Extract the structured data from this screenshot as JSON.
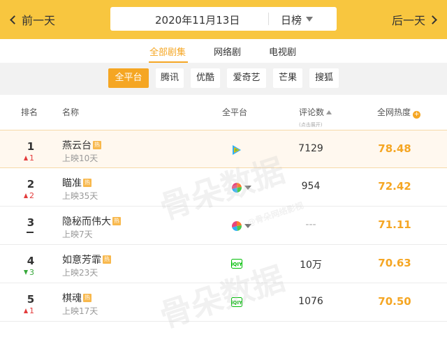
{
  "nav": {
    "prev_label": "前一天",
    "next_label": "后一天",
    "date": "2020年11月13日",
    "mode": "日榜"
  },
  "category_tabs": [
    {
      "label": "全部剧集",
      "active": true
    },
    {
      "label": "网络剧",
      "active": false
    },
    {
      "label": "电视剧",
      "active": false
    }
  ],
  "platforms": [
    {
      "label": "全平台",
      "active": true
    },
    {
      "label": "腾讯",
      "active": false
    },
    {
      "label": "优酷",
      "active": false
    },
    {
      "label": "爱奇艺",
      "active": false
    },
    {
      "label": "芒果",
      "active": false
    },
    {
      "label": "搜狐",
      "active": false
    }
  ],
  "table_header": {
    "rank": "排名",
    "name": "名称",
    "platform": "全平台",
    "comments": "评论数",
    "comments_hint": "(点击展开)",
    "heat": "全网热度",
    "heat_badge": "+"
  },
  "rows": [
    {
      "rank": "1",
      "change": "1",
      "change_dir": "up",
      "title": "燕云台",
      "badge": "热",
      "days": "上映10天",
      "platform_icon": "tencent-video-icon",
      "comments": "7129",
      "heat": "78.48"
    },
    {
      "rank": "2",
      "change": "2",
      "change_dir": "up",
      "title": "瞄准",
      "badge": "热",
      "days": "上映35天",
      "platform_icon": "multi-platform-icon",
      "comments": "954",
      "heat": "72.42"
    },
    {
      "rank": "3",
      "change": "",
      "change_dir": "flat",
      "title": "隐秘而伟大",
      "badge": "热",
      "days": "上映7天",
      "platform_icon": "multi-platform-icon",
      "comments": "---",
      "heat": "71.11"
    },
    {
      "rank": "4",
      "change": "3",
      "change_dir": "down",
      "title": "如意芳霏",
      "badge": "热",
      "days": "上映23天",
      "platform_icon": "iqiyi-icon",
      "comments": "10万",
      "heat": "70.63"
    },
    {
      "rank": "5",
      "change": "1",
      "change_dir": "up",
      "title": "棋魂",
      "badge": "热",
      "days": "上映17天",
      "platform_icon": "iqiyi-icon",
      "comments": "1076",
      "heat": "70.50"
    }
  ],
  "watermark": {
    "main": "骨朵数据",
    "sub": "@骨朵网络影视"
  },
  "colors": {
    "topbar": "#f8c63f",
    "accent": "#f5a623",
    "up": "#e33b3b",
    "down": "#36a83a"
  }
}
